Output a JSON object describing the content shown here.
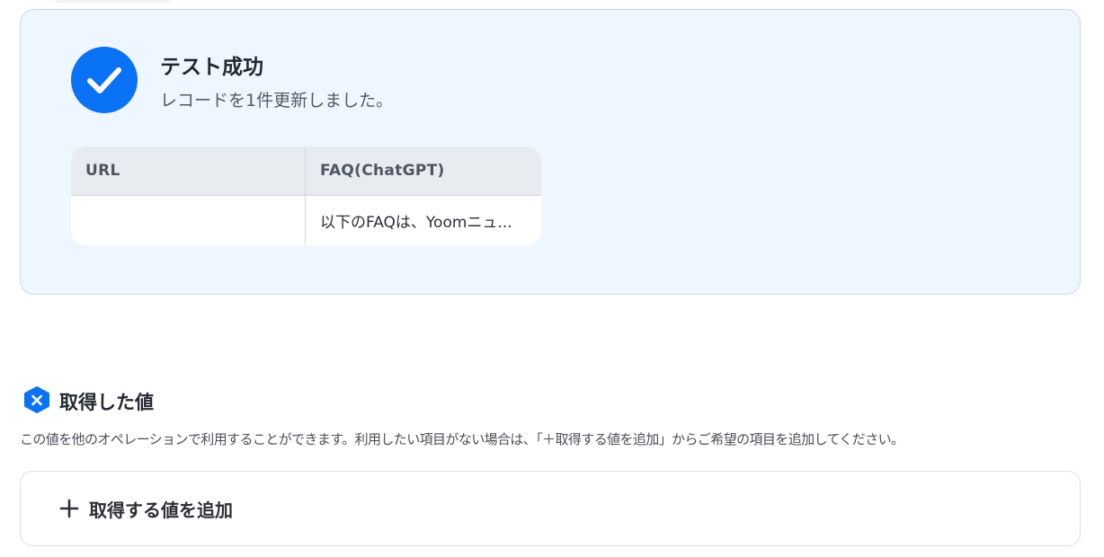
{
  "result": {
    "title": "テスト成功",
    "subtitle": "レコードを1件更新しました。",
    "table": {
      "headers": [
        "URL",
        "FAQ(ChatGPT)"
      ],
      "rows": [
        [
          "",
          "以下のFAQは、Yoomニュ..."
        ]
      ]
    }
  },
  "section": {
    "title": "取得した値",
    "description": "この値を他のオペレーションで利用することができます。利用したい項目がない場合は、「＋取得する値を追加」からご希望の項目を追加してください。"
  },
  "add_value": {
    "label": "取得する値を追加"
  },
  "icons": {
    "success": "check-circle-icon",
    "section": "yoom-x-icon",
    "add": "plus-icon"
  },
  "colors": {
    "accent": "#0a73f5",
    "card_background": "#eef6ff"
  }
}
